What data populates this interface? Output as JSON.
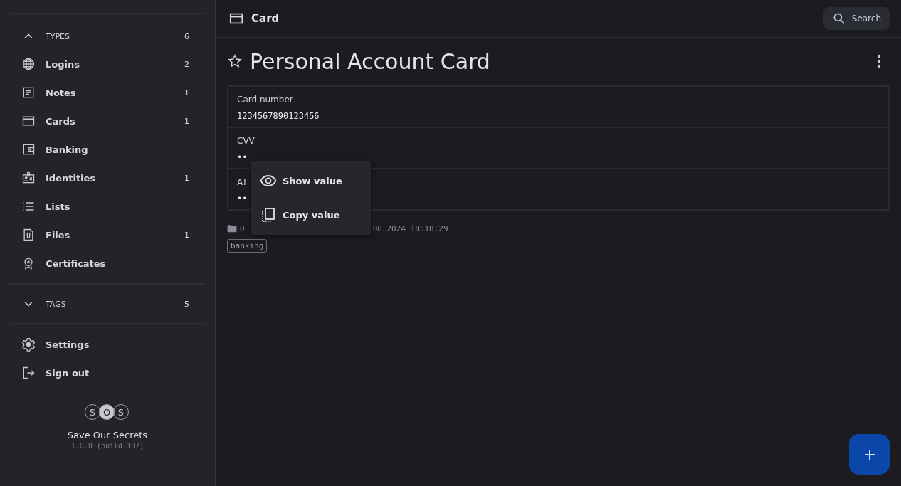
{
  "sidebar": {
    "types": {
      "label": "TYPES",
      "count": "6",
      "expanded": true,
      "items": [
        {
          "label": "Logins",
          "count": "2"
        },
        {
          "label": "Notes",
          "count": "1"
        },
        {
          "label": "Cards",
          "count": "1"
        },
        {
          "label": "Banking"
        },
        {
          "label": "Identities",
          "count": "1"
        },
        {
          "label": "Lists"
        },
        {
          "label": "Files",
          "count": "1"
        },
        {
          "label": "Certificates"
        }
      ]
    },
    "tags": {
      "label": "TAGS",
      "count": "5",
      "expanded": false
    },
    "actions": [
      {
        "label": "Settings"
      },
      {
        "label": "Sign out"
      }
    ],
    "logo": [
      "S",
      "O",
      "S"
    ],
    "app_name": "Save Our Secrets",
    "version": "1.0.0 (build 107)"
  },
  "header": {
    "title": "Card",
    "search": "Search"
  },
  "secret": {
    "title": "Personal Account Card",
    "favorite": false,
    "fields": [
      {
        "label": "Card number",
        "value": "1234567890123456"
      },
      {
        "label": "CVV",
        "value": "••"
      },
      {
        "label": "AT",
        "value": "••"
      }
    ],
    "folder": "D",
    "date": "08 2024 18:18:29",
    "tags": [
      "banking"
    ]
  },
  "context_menu": [
    {
      "label": "Show value"
    },
    {
      "label": "Copy value"
    }
  ]
}
